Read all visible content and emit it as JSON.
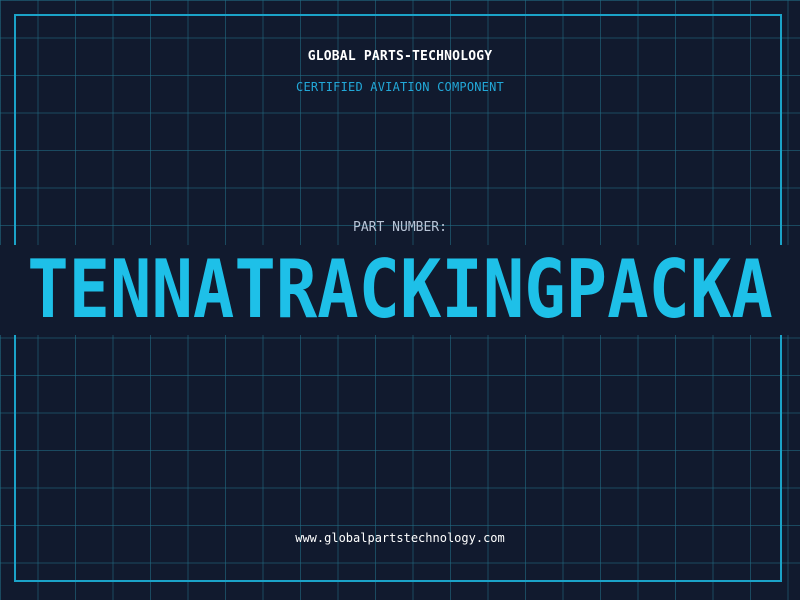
{
  "header": {
    "company": "GLOBAL PARTS-TECHNOLOGY",
    "tagline": "CERTIFIED AVIATION COMPONENT"
  },
  "part": {
    "label": "PART NUMBER:",
    "number": "TENNATRACKINGPACKA"
  },
  "footer": {
    "website": "www.globalpartstechnology.com"
  },
  "colors": {
    "background": "#111a2e",
    "grid": "#227088",
    "frame": "#1ba3c8",
    "accent": "#1ec0e8"
  }
}
